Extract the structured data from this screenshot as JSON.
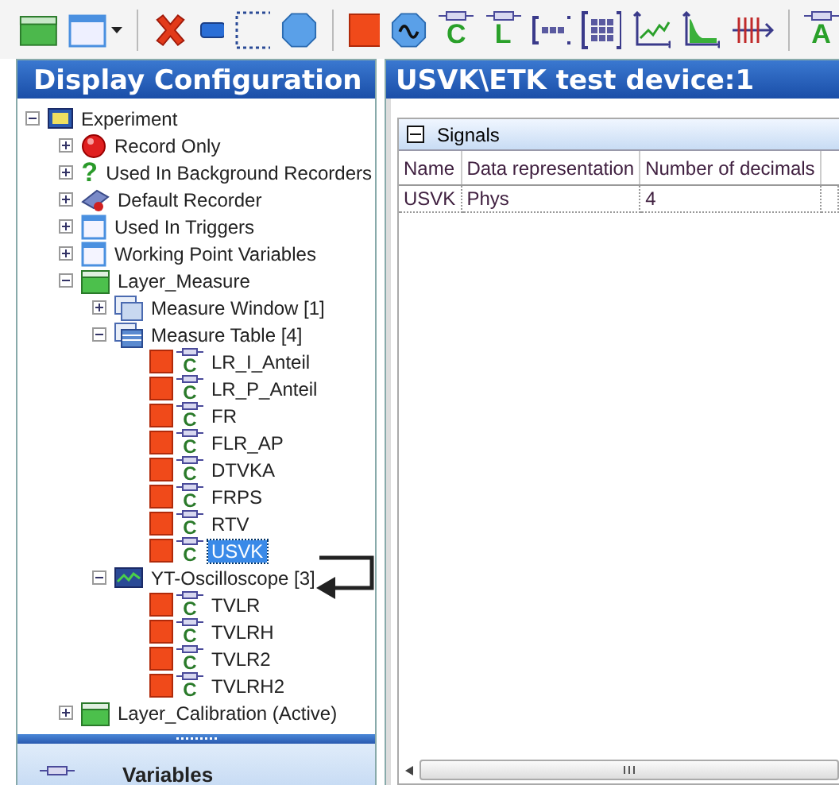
{
  "toolbar": [
    {
      "kind": "folder"
    },
    {
      "kind": "window-menu"
    },
    {
      "kind": "sep"
    },
    {
      "kind": "delete"
    },
    {
      "kind": "bar"
    },
    {
      "kind": "frame"
    },
    {
      "kind": "octagon"
    },
    {
      "kind": "sep"
    },
    {
      "kind": "square"
    },
    {
      "kind": "wave"
    },
    {
      "kind": "tag",
      "glyph": "C"
    },
    {
      "kind": "tag",
      "glyph": "L"
    },
    {
      "kind": "bracket"
    },
    {
      "kind": "grid"
    },
    {
      "kind": "line-chart"
    },
    {
      "kind": "area-chart"
    },
    {
      "kind": "ticks"
    },
    {
      "kind": "sep"
    },
    {
      "kind": "tag",
      "glyph": "A"
    }
  ],
  "left_panel": {
    "title": "Display Configuration",
    "tree": [
      {
        "label": "Experiment",
        "kind": "experiment",
        "expanded": true,
        "selected": false,
        "children": [
          {
            "label": "Record Only",
            "kind": "record",
            "expanded": false,
            "selected": false
          },
          {
            "label": "Used In Background Recorders",
            "kind": "question",
            "glyph": "?",
            "expanded": false,
            "selected": false
          },
          {
            "label": "Default Recorder",
            "kind": "recorder",
            "expanded": false,
            "selected": false
          },
          {
            "label": "Used In Triggers",
            "kind": "window",
            "expanded": false,
            "selected": false
          },
          {
            "label": "Working Point Variables",
            "kind": "window",
            "expanded": false,
            "selected": false
          },
          {
            "label": "Layer_Measure",
            "kind": "layer",
            "expanded": true,
            "selected": false,
            "children": [
              {
                "label": "Measure Window [1]",
                "kind": "measure-window",
                "expanded": false,
                "selected": false
              },
              {
                "label": "Measure Table [4]",
                "kind": "measure-table",
                "expanded": true,
                "selected": false,
                "children": [
                  {
                    "label": "LR_I_Anteil",
                    "kind": "signal",
                    "glyph": "C",
                    "selected": false
                  },
                  {
                    "label": "LR_P_Anteil",
                    "kind": "signal",
                    "glyph": "C",
                    "selected": false
                  },
                  {
                    "label": "FR",
                    "kind": "signal",
                    "glyph": "C",
                    "selected": false
                  },
                  {
                    "label": "FLR_AP",
                    "kind": "signal",
                    "glyph": "C",
                    "selected": false
                  },
                  {
                    "label": "DTVKA",
                    "kind": "signal",
                    "glyph": "C",
                    "selected": false
                  },
                  {
                    "label": "FRPS",
                    "kind": "signal",
                    "glyph": "C",
                    "selected": false
                  },
                  {
                    "label": "RTV",
                    "kind": "signal",
                    "glyph": "C",
                    "selected": false
                  },
                  {
                    "label": "USVK",
                    "kind": "signal",
                    "glyph": "C",
                    "selected": true
                  }
                ]
              },
              {
                "label": "YT-Oscilloscope [3]",
                "kind": "oscilloscope",
                "expanded": true,
                "selected": false,
                "children": [
                  {
                    "label": "TVLR",
                    "kind": "signal",
                    "glyph": "C",
                    "selected": false
                  },
                  {
                    "label": "TVLRH",
                    "kind": "signal",
                    "glyph": "C",
                    "selected": false
                  },
                  {
                    "label": "TVLR2",
                    "kind": "signal",
                    "glyph": "C",
                    "selected": false
                  },
                  {
                    "label": "TVLRH2",
                    "kind": "signal",
                    "glyph": "C",
                    "selected": false
                  }
                ]
              }
            ]
          },
          {
            "label": "Layer_Calibration (Active)",
            "kind": "layer",
            "expanded": false,
            "selected": false
          }
        ]
      }
    ],
    "bottom_tab": "Variables"
  },
  "right_panel": {
    "title": "USVK\\ETK test device:1",
    "group": {
      "title": "Signals",
      "expanded": true,
      "table": {
        "columns": [
          "Name",
          "Data representation",
          "Number of decimals"
        ],
        "rows": [
          [
            "USVK",
            "Phys",
            "4"
          ]
        ]
      }
    }
  }
}
